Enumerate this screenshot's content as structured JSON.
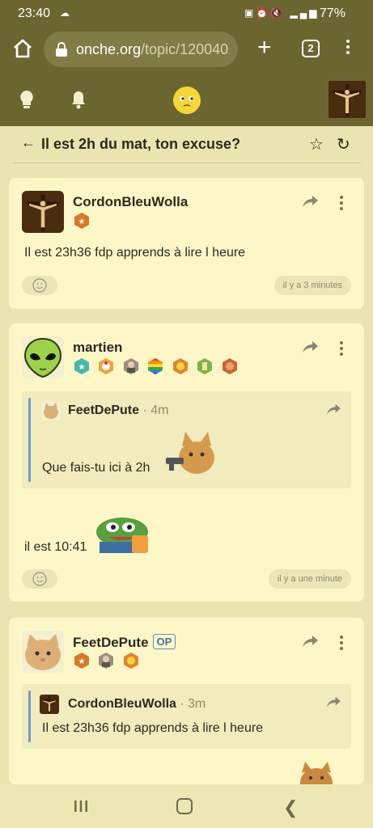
{
  "status": {
    "time": "23:40",
    "battery": "77%",
    "network": "4G"
  },
  "browser": {
    "url_domain": "onche.org",
    "url_path": "/topic/120040",
    "tab_count": "2"
  },
  "topic": {
    "title": "Il est 2h du mat, ton excuse?"
  },
  "posts": [
    {
      "author": "CordonBleuWolla",
      "op": "",
      "message": "Il est 23h36 fdp apprends à lire l heure",
      "time": "il y a 3 minutes"
    },
    {
      "author": "martien",
      "op": "",
      "quote": {
        "author": "FeetDePute",
        "time": "· 4m",
        "message": "Que fais-tu ici à 2h"
      },
      "message": "il est 10:41",
      "time": "il y a une minute"
    },
    {
      "author": "FeetDePute",
      "op": "OP",
      "quote": {
        "author": "CordonBleuWolla",
        "time": "· 3m",
        "message": "Il est 23h36 fdp apprends à lire l heure"
      }
    }
  ],
  "colors": {
    "header": "#6b6630",
    "card": "#fdf7c8",
    "page": "#eae5b0",
    "quote_bar": "#6f9bc9"
  }
}
